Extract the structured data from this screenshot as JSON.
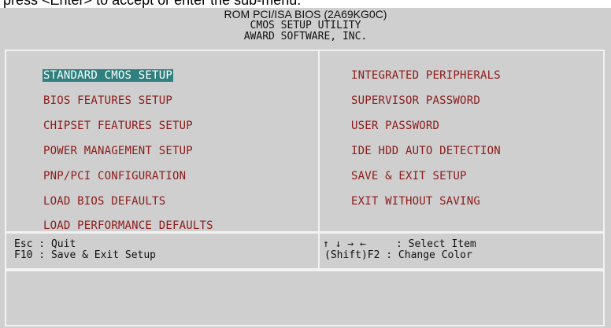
{
  "caption": "press <Enter> to accept or enter the sub-menu.",
  "header": {
    "line1": "ROM PCI/ISA BIOS (2A69KG0C)",
    "line2": "CMOS SETUP UTILITY",
    "line3": "AWARD SOFTWARE, INC."
  },
  "menu": {
    "left": [
      "STANDARD CMOS SETUP",
      "BIOS FEATURES SETUP",
      "CHIPSET FEATURES SETUP",
      "POWER MANAGEMENT SETUP",
      "PNP/PCI CONFIGURATION",
      "LOAD BIOS DEFAULTS",
      "LOAD PERFORMANCE DEFAULTS"
    ],
    "right": [
      "INTEGRATED PERIPHERALS",
      "SUPERVISOR PASSWORD",
      "USER PASSWORD",
      "IDE HDD AUTO DETECTION",
      "SAVE & EXIT SETUP",
      "EXIT WITHOUT SAVING"
    ],
    "selected": "STANDARD CMOS SETUP"
  },
  "help": {
    "esc": "Esc : Quit",
    "f10": "F10 : Save & Exit Setup",
    "arrows": "↑ ↓ → ←",
    "select": ": Select Item",
    "shift": "(Shift)F2 : Change Color"
  },
  "colors": {
    "background": "#cfcfcf",
    "item_text": "#8c1b1b",
    "highlight": "#2f7f7f"
  }
}
